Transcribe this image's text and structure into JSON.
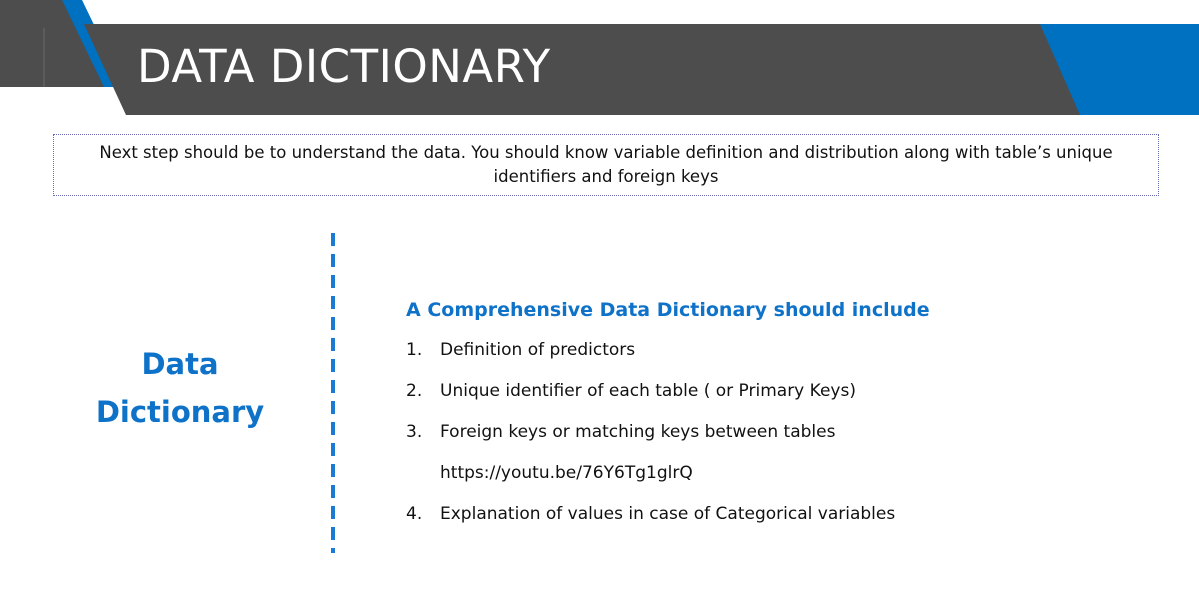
{
  "slide": {
    "title": "DATA DICTIONARY",
    "colors": {
      "banner_dark": "#4d4d4d",
      "accent_blue": "#0070c0",
      "heading_blue": "#0f72c9",
      "text": "#111111"
    }
  },
  "intro": {
    "text": "Next step should be to understand the data. You should know variable definition and distribution along with table’s unique identifiers and foreign keys"
  },
  "sidebar": {
    "heading_line1": "Data",
    "heading_line2": "Dictionary"
  },
  "content": {
    "heading": "A Comprehensive Data Dictionary should include",
    "items": [
      {
        "number": "1.",
        "text": "Definition of predictors"
      },
      {
        "number": "2.",
        "text": "Unique identifier of each table ( or Primary Keys)"
      },
      {
        "number": "3.",
        "text": "Foreign keys or matching keys between tables"
      },
      {
        "number": "4.",
        "text": "Explanation of values in case of Categorical variables"
      }
    ],
    "link": "https://youtu.be/76Y6Tg1glrQ"
  }
}
